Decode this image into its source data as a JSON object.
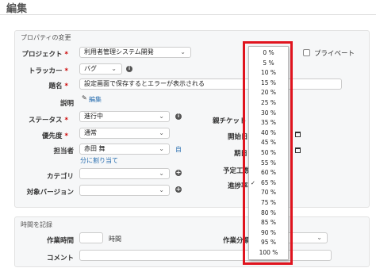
{
  "page": {
    "title": "編集"
  },
  "properties": {
    "legend": "プロパティの変更",
    "project": {
      "label": "プロジェクト",
      "value": "利用者管理システム開発"
    },
    "private": {
      "label": "プライベート"
    },
    "tracker": {
      "label": "トラッカー",
      "value": "バグ"
    },
    "subject": {
      "label": "題名",
      "value": "設定画面で保存するとエラーが表示される"
    },
    "description": {
      "label": "説明",
      "edit_link": "編集"
    },
    "status": {
      "label": "ステータス",
      "value": "進行中"
    },
    "priority": {
      "label": "優先度",
      "value": "通常"
    },
    "assignee": {
      "label": "担当者",
      "value": "赤田 舞",
      "self_link": "自",
      "assign_me_link": "分に割り当て"
    },
    "category": {
      "label": "カテゴリ"
    },
    "version": {
      "label": "対象バージョン"
    },
    "parent_ticket": {
      "label": "親チケット"
    },
    "start_date": {
      "label": "開始日"
    },
    "due_date": {
      "label": "期日"
    },
    "estimated": {
      "label": "予定工数"
    },
    "done_ratio": {
      "label": "進捗率"
    }
  },
  "done_ratio_dropdown": {
    "options": [
      "0 %",
      "5 %",
      "10 %",
      "15 %",
      "20 %",
      "25 %",
      "30 %",
      "35 %",
      "40 %",
      "45 %",
      "50 %",
      "55 %",
      "60 %",
      "65 %",
      "70 %",
      "75 %",
      "80 %",
      "85 %",
      "90 %",
      "95 %",
      "100 %"
    ],
    "selected": "65 %",
    "highlight_color": "#e0141e"
  },
  "time_entry": {
    "legend": "時間を記録",
    "hours": {
      "label": "作業時間",
      "unit": "時間"
    },
    "activity": {
      "label": "作業分類"
    },
    "comment": {
      "label": "コメント"
    }
  }
}
